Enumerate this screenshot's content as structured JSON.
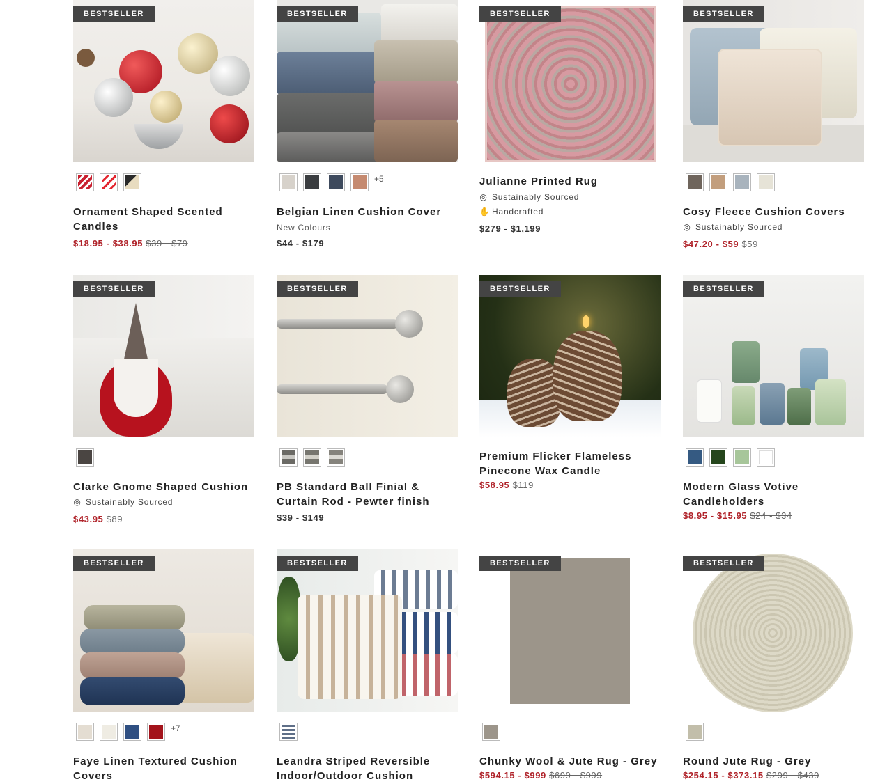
{
  "badge_text": "BESTSELLER",
  "products": [
    {
      "title": "Ornament Shaped Scented Candles",
      "swatches": [
        "#c8202f",
        "#e3262f",
        "#d9d2c0"
      ],
      "more": "",
      "sub": "",
      "attrs": [],
      "price_sale": "$18.95 - $38.95",
      "price_was": "$39 - $79",
      "price_reg": ""
    },
    {
      "title": "Belgian Linen Cushion Cover",
      "swatches": [
        "#d7d2cb",
        "#3a3d40",
        "#3e4a5d",
        "#c58a70"
      ],
      "more": "+5",
      "sub": "New Colours",
      "attrs": [],
      "price_sale": "",
      "price_was": "",
      "price_reg": "$44 - $179"
    },
    {
      "title": "Julianne Printed Rug",
      "swatches": [],
      "more": "",
      "sub": "",
      "attrs": [
        {
          "icon": "globe-icon",
          "glyph": "◎",
          "label": "Sustainably Sourced"
        },
        {
          "icon": "hand-icon",
          "glyph": "✋",
          "label": "Handcrafted"
        }
      ],
      "price_sale": "",
      "price_was": "",
      "price_reg": "$279 - $1,199"
    },
    {
      "title": "Cosy Fleece Cushion Covers",
      "swatches": [
        "#6f655c",
        "#c29e7d",
        "#a8b3bd",
        "#e6e3d7"
      ],
      "more": "",
      "sub": "",
      "attrs": [
        {
          "icon": "globe-icon",
          "glyph": "◎",
          "label": "Sustainably Sourced"
        }
      ],
      "price_sale": "$47.20 - $59",
      "price_was": "$59",
      "price_reg": ""
    },
    {
      "title": "Clarke Gnome Shaped Cushion",
      "swatches": [
        "#4a4542"
      ],
      "more": "",
      "sub": "",
      "attrs": [
        {
          "icon": "globe-icon",
          "glyph": "◎",
          "label": "Sustainably Sourced"
        }
      ],
      "price_sale": "$43.95",
      "price_was": "$89",
      "price_reg": ""
    },
    {
      "title": "PB Standard Ball Finial & Curtain Rod - Pewter finish",
      "swatches": [
        "#6b6a65",
        "#77766f",
        "#85837c"
      ],
      "more": "",
      "sub": "",
      "attrs": [],
      "price_sale": "",
      "price_was": "",
      "price_reg": "$39 - $149"
    },
    {
      "title": "Premium Flicker Flameless Pinecone Wax Candle",
      "swatches": [],
      "more": "",
      "sub": "",
      "attrs": [],
      "price_sale": "$58.95",
      "price_was": "$119",
      "price_reg": ""
    },
    {
      "title": "Modern Glass Votive Candleholders",
      "swatches": [
        "#355a82",
        "#25461c",
        "#a7c69a",
        "#ffffff"
      ],
      "more": "",
      "sub": "",
      "attrs": [],
      "price_sale": "$8.95 - $15.95",
      "price_was": "$24 - $34",
      "price_reg": ""
    },
    {
      "title": "Faye Linen Textured Cushion Covers",
      "swatches": [
        "#e4ddd2",
        "#efece3",
        "#2f4f82",
        "#a3131b"
      ],
      "more": "+7",
      "sub": "",
      "attrs": [],
      "price_sale": "",
      "price_was": "",
      "price_reg": ""
    },
    {
      "title": "Leandra Striped Reversible Indoor/Outdoor Cushion",
      "swatches": [
        "#5f6f88"
      ],
      "more": "",
      "sub": "",
      "attrs": [],
      "price_sale": "",
      "price_was": "",
      "price_reg": ""
    },
    {
      "title": "Chunky Wool & Jute Rug - Grey",
      "swatches": [
        "#9c958a"
      ],
      "more": "",
      "sub": "",
      "attrs": [],
      "price_sale": "$594.15 - $999",
      "price_was": "$699 - $999",
      "price_reg": ""
    },
    {
      "title": "Round Jute Rug - Grey",
      "swatches": [
        "#c2beaa"
      ],
      "more": "",
      "sub": "",
      "attrs": [],
      "price_sale": "$254.15 - $373.15",
      "price_was": "$299 - $439",
      "price_reg": ""
    }
  ]
}
